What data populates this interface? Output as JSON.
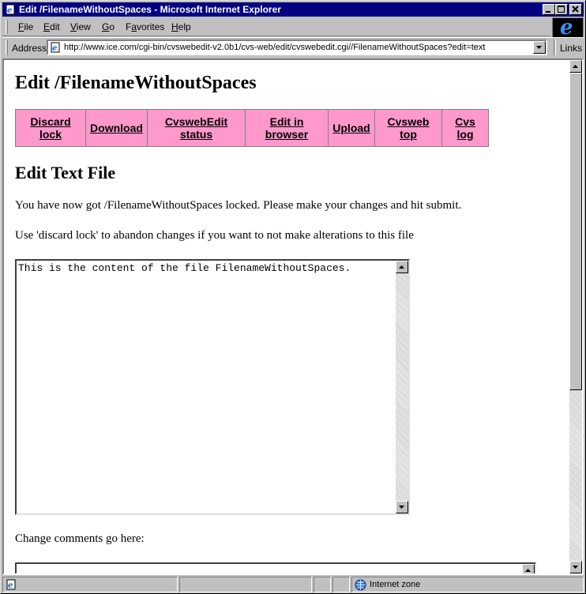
{
  "window": {
    "title": "Edit /FilenameWithoutSpaces - Microsoft Internet Explorer",
    "buttons": {
      "minimize": "_",
      "maximize": "□",
      "close": "×"
    }
  },
  "menu": {
    "items": [
      {
        "label": "File",
        "key": "F"
      },
      {
        "label": "Edit",
        "key": "E"
      },
      {
        "label": "View",
        "key": "V"
      },
      {
        "label": "Go",
        "key": "G"
      },
      {
        "label": "Favorites",
        "key": "a"
      },
      {
        "label": "Help",
        "key": "H"
      }
    ]
  },
  "address": {
    "label": "Address",
    "url": "http://www.ice.com/cgi-bin/cvswebedit-v2.0b1/cvs-web/edit/cvswebedit.cgi//FilenameWithoutSpaces?edit=text",
    "links_label": "Links"
  },
  "page": {
    "title": "Edit /FilenameWithoutSpaces",
    "nav": [
      {
        "line1": "Discard",
        "line2": "lock"
      },
      {
        "line1": "Download",
        "line2": ""
      },
      {
        "line1": "CvswebEdit",
        "line2": "status"
      },
      {
        "line1": "Edit in",
        "line2": "browser"
      },
      {
        "line1": "Upload",
        "line2": ""
      },
      {
        "line1": "Cvsweb",
        "line2": "top"
      },
      {
        "line1": "Cvs",
        "line2": "log"
      }
    ],
    "section_title": "Edit Text File",
    "para1": "You have now got /FilenameWithoutSpaces locked. Please make your changes and hit submit.",
    "para2": "Use 'discard lock' to abandon changes if you want to not make alterations to this file",
    "file_content": "This is the content of the file FilenameWithoutSpaces.",
    "comments_label": "Change comments go here:",
    "comments_value": ""
  },
  "status": {
    "zone": "Internet zone"
  },
  "colors": {
    "titlebar": "#000080",
    "nav_bg": "#ff99cc"
  }
}
